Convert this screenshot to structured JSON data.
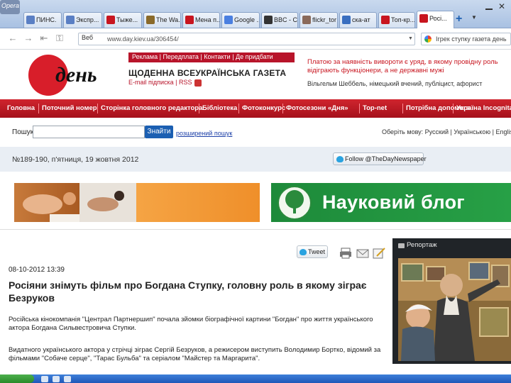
{
  "browser": {
    "opera_label": "Opera",
    "tabs": [
      {
        "title": "ПИНС.",
        "color": "#5a7fc4"
      },
      {
        "title": "Экспр...",
        "color": "#5a7fc4"
      },
      {
        "title": "Тыже...",
        "color": "#c8151f"
      },
      {
        "title": "The Wa...",
        "color": "#8a6a2a"
      },
      {
        "title": "Мена п...",
        "color": "#c8151f"
      },
      {
        "title": "Google ...",
        "color": "#4a7fe0"
      },
      {
        "title": "BBC - C",
        "color": "#333333"
      },
      {
        "title": "flickr_tor",
        "color": "#8a6a5a"
      },
      {
        "title": "ска-ат",
        "color": "#3a6fc0"
      },
      {
        "title": "Топ-кр...",
        "color": "#c8151f"
      },
      {
        "title": "Росі...",
        "color": "#c8151f"
      }
    ],
    "new_tab": "+",
    "address": "www.day.kiev.ua/306454/",
    "web_tag": "Веб",
    "google_search_placeholder": "Ігрек ступку газета день"
  },
  "site": {
    "logo_text": "день",
    "top_links": "Реклама | Передплата | Контакти | Де придбати",
    "tagline": "ЩОДЕННА ВСЕУКРАЇНСЬКА ГАЗЕТА",
    "subscription": "Е-mail підписка | RSS",
    "quote": "Платою за наявність вивороти є уряд, в якому провідну роль відіграють функціонери, а не державні мужі",
    "quote_author": "Вільгельм Шеббель, німецький вчений, публіцист, афорист",
    "nav_items": [
      "Головна",
      "Поточний номер",
      "Сторінка головного редактора",
      "Бібліотека",
      "Фотоконкурс",
      "Фотосезони «Дня»",
      "Top-net",
      "Потрібна допомога",
      "Україна Incognita"
    ],
    "search_label": "Пошук",
    "search_button": "Знайти",
    "advanced_search": "розширений пошук",
    "language_label": "Оберіть мову: Русский | Українською | English",
    "issue_date": "№189-190, п'ятниця, 19 жовтня 2012",
    "follow_label": "Follow @TheDayNewspaper",
    "banner_blog": "Науковий блог",
    "tweet_label": "Tweet",
    "article_date": "08-10-2012 13:39",
    "headline": "Росіяни знімуть фільм про Богдана Ступку, головну роль в якому зіграє Безруков",
    "lead": "Російська кінокомпанія \"Централ Партнершип\" почала зйомки біографічної картини \"Богдан\" про життя українського актора Богдана Сильвестровича Ступки.",
    "para2": "Видатного українського актора у стрічці зіграє Сергій Безруков, а режисером виступить Володимир Бортко, відомий за фільмами \"Собаче серце\", \"Тарас Бульба\" та серіалом \"Майстер та Маргарита\".",
    "side_title": "Репортаж"
  },
  "colors": {
    "brand_red": "#b8142a",
    "quote_red": "#c8151f",
    "blog_green": "#27a046"
  }
}
